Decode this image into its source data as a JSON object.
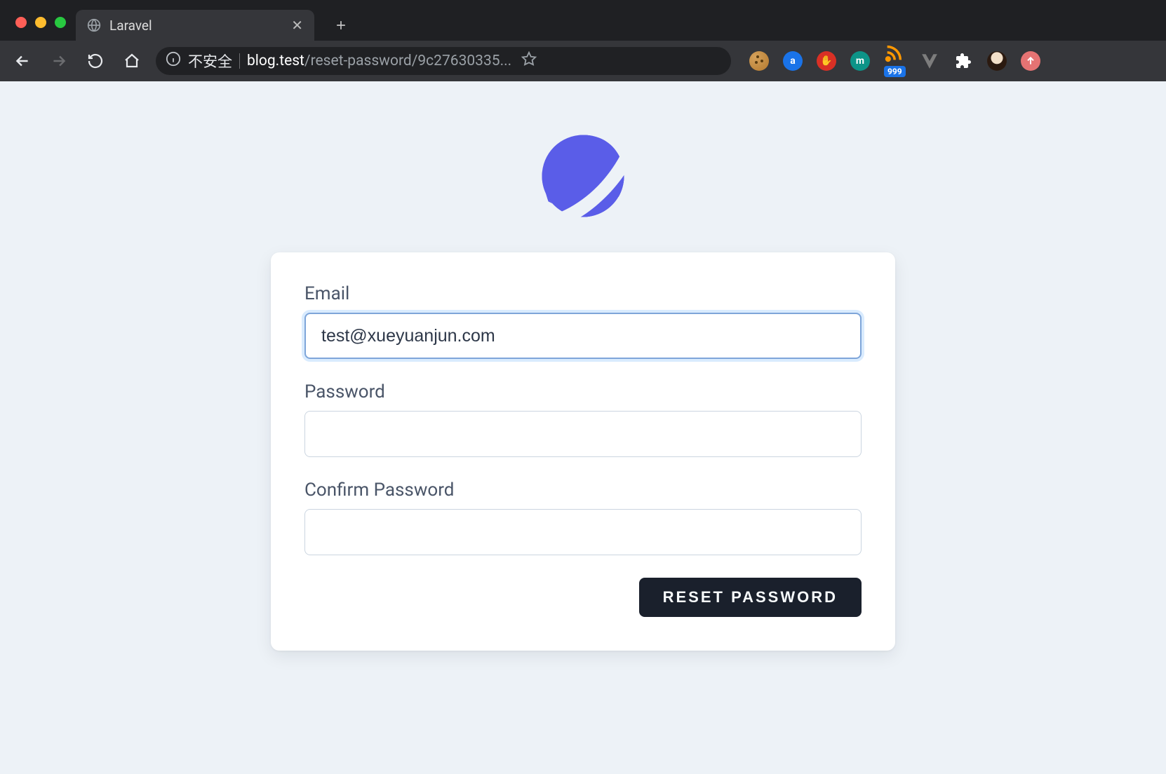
{
  "browser": {
    "tab_title": "Laravel",
    "not_secure_label": "不安全",
    "url_host": "blog.test",
    "url_path": "/reset-password/9c27630335...",
    "extension_badge": "999"
  },
  "form": {
    "email_label": "Email",
    "email_value": "test@xueyuanjun.com",
    "password_label": "Password",
    "password_value": "",
    "confirm_label": "Confirm Password",
    "confirm_value": "",
    "submit_label": "RESET PASSWORD"
  }
}
